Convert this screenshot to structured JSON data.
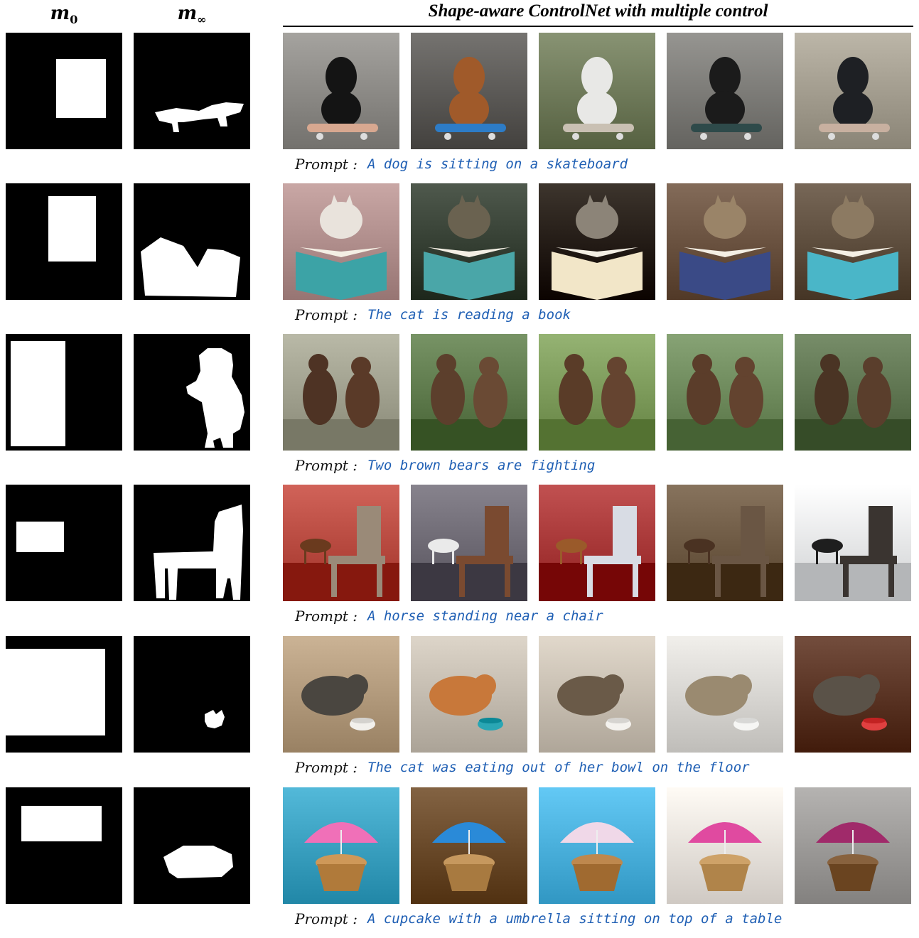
{
  "header": {
    "col_m0": "m",
    "col_m0_sub": "0",
    "col_minf": "m",
    "col_minf_sub": "∞",
    "title": "Shape-aware ControlNet with multiple control"
  },
  "prompt_label": "Prompt :",
  "rows": [
    {
      "prompt": "A dog is sitting on a skateboard",
      "samples": [
        {
          "subject": "dog",
          "object": "skateboard",
          "colors": {
            "bg": "#8c8a86",
            "fg": "#141414",
            "obj": "#d8a890"
          }
        },
        {
          "subject": "dog",
          "object": "skateboard",
          "colors": {
            "bg": "#5c5a57",
            "fg": "#a05a2a",
            "obj": "#2d7cc7"
          }
        },
        {
          "subject": "dog",
          "object": "skateboard",
          "colors": {
            "bg": "#6f7a5a",
            "fg": "#e8e8e6",
            "obj": "#c9c0b3"
          }
        },
        {
          "subject": "dog",
          "object": "skateboard",
          "colors": {
            "bg": "#7d7c78",
            "fg": "#1b1b1b",
            "obj": "#2e4a4a"
          }
        },
        {
          "subject": "dog",
          "object": "skateboard",
          "colors": {
            "bg": "#a39d8f",
            "fg": "#1e2024",
            "obj": "#c8b0a0"
          }
        }
      ]
    },
    {
      "prompt": "The cat is reading a book",
      "samples": [
        {
          "subject": "cat",
          "object": "book",
          "colors": {
            "bg": "#b08e8c",
            "fg": "#e9e3dc",
            "obj": "#3ca3a6"
          }
        },
        {
          "subject": "cat",
          "object": "book",
          "colors": {
            "bg": "#364034",
            "fg": "#6a6250",
            "obj": "#4aa6a8"
          }
        },
        {
          "subject": "cat",
          "object": "book",
          "colors": {
            "bg": "#241c14",
            "fg": "#8c8478",
            "obj": "#f2e6c8"
          }
        },
        {
          "subject": "cat",
          "object": "book",
          "colors": {
            "bg": "#6a5240",
            "fg": "#9a8468",
            "obj": "#3a4a86"
          }
        },
        {
          "subject": "cat",
          "object": "book",
          "colors": {
            "bg": "#5e4e3e",
            "fg": "#8c7a62",
            "obj": "#4ab6c8"
          }
        }
      ]
    },
    {
      "prompt": "Two brown bears are fighting",
      "samples": [
        {
          "subject": "bear",
          "object": "bear",
          "colors": {
            "bg": "#a0a08e",
            "fg": "#4e3324",
            "obj": "#5a3a28"
          }
        },
        {
          "subject": "bear",
          "object": "bear",
          "colors": {
            "bg": "#5e7a4c",
            "fg": "#5c3f2c",
            "obj": "#6a4a34"
          }
        },
        {
          "subject": "bear",
          "object": "bear",
          "colors": {
            "bg": "#7c9a5a",
            "fg": "#5a3c28",
            "obj": "#654430"
          }
        },
        {
          "subject": "bear",
          "object": "bear",
          "colors": {
            "bg": "#6e8a5c",
            "fg": "#5b3d2a",
            "obj": "#63432f"
          }
        },
        {
          "subject": "bear",
          "object": "bear",
          "colors": {
            "bg": "#5e7450",
            "fg": "#4a3424",
            "obj": "#5a3e2c"
          }
        }
      ]
    },
    {
      "prompt": "A horse standing near a chair",
      "samples": [
        {
          "subject": "horse",
          "object": "chair",
          "colors": {
            "bg": "#b84a40",
            "fg": "#6a3a1e",
            "obj": "#9a8a78"
          }
        },
        {
          "subject": "horse",
          "object": "chair",
          "colors": {
            "bg": "#6e6a74",
            "fg": "#eaeaea",
            "obj": "#7a4a30"
          }
        },
        {
          "subject": "horse",
          "object": "chair",
          "colors": {
            "bg": "#a83838",
            "fg": "#9a5a2a",
            "obj": "#d8dce4"
          }
        },
        {
          "subject": "horse",
          "object": "chair",
          "colors": {
            "bg": "#6e5a44",
            "fg": "#4a3222",
            "obj": "#6a5644"
          }
        },
        {
          "subject": "horse",
          "object": "chair",
          "colors": {
            "bg": "#e6e8ea",
            "fg": "#1e1e1e",
            "obj": "#3a3430"
          }
        }
      ]
    },
    {
      "prompt": "The cat was eating out of her bowl on the floor",
      "samples": [
        {
          "subject": "cat",
          "object": "bowl",
          "colors": {
            "bg": "#b29a7c",
            "fg": "#4a4640",
            "obj": "#f2f0ec"
          }
        },
        {
          "subject": "cat",
          "object": "bowl",
          "colors": {
            "bg": "#c4bcb0",
            "fg": "#c8783a",
            "obj": "#2aa6b4"
          }
        },
        {
          "subject": "cat",
          "object": "bowl",
          "colors": {
            "bg": "#c8bfb2",
            "fg": "#6a5a48",
            "obj": "#f4f2ee"
          }
        },
        {
          "subject": "cat",
          "object": "bowl",
          "colors": {
            "bg": "#d8d6d2",
            "fg": "#9a8a70",
            "obj": "#f6f6f4"
          }
        },
        {
          "subject": "cat",
          "object": "bowl",
          "colors": {
            "bg": "#5a3424",
            "fg": "#5a5248",
            "obj": "#e04040"
          }
        }
      ]
    },
    {
      "prompt": "A cupcake with a umbrella sitting on top of a table",
      "samples": [
        {
          "subject": "cupcake",
          "object": "umbrella",
          "colors": {
            "bg": "#3aa0c0",
            "fg": "#b07a3a",
            "obj": "#f070b8"
          }
        },
        {
          "subject": "cupcake",
          "object": "umbrella",
          "colors": {
            "bg": "#6a4a2a",
            "fg": "#a87a40",
            "obj": "#2a8ad8"
          }
        },
        {
          "subject": "cupcake",
          "object": "umbrella",
          "colors": {
            "bg": "#4ab0dc",
            "fg": "#a06a30",
            "obj": "#f0d8e8"
          }
        },
        {
          "subject": "cupcake",
          "object": "umbrella",
          "colors": {
            "bg": "#e8e2dc",
            "fg": "#b0844a",
            "obj": "#e04aa0"
          }
        },
        {
          "subject": "cupcake",
          "object": "umbrella",
          "colors": {
            "bg": "#9c9a98",
            "fg": "#6a4420",
            "obj": "#a02a6a"
          }
        }
      ]
    }
  ]
}
